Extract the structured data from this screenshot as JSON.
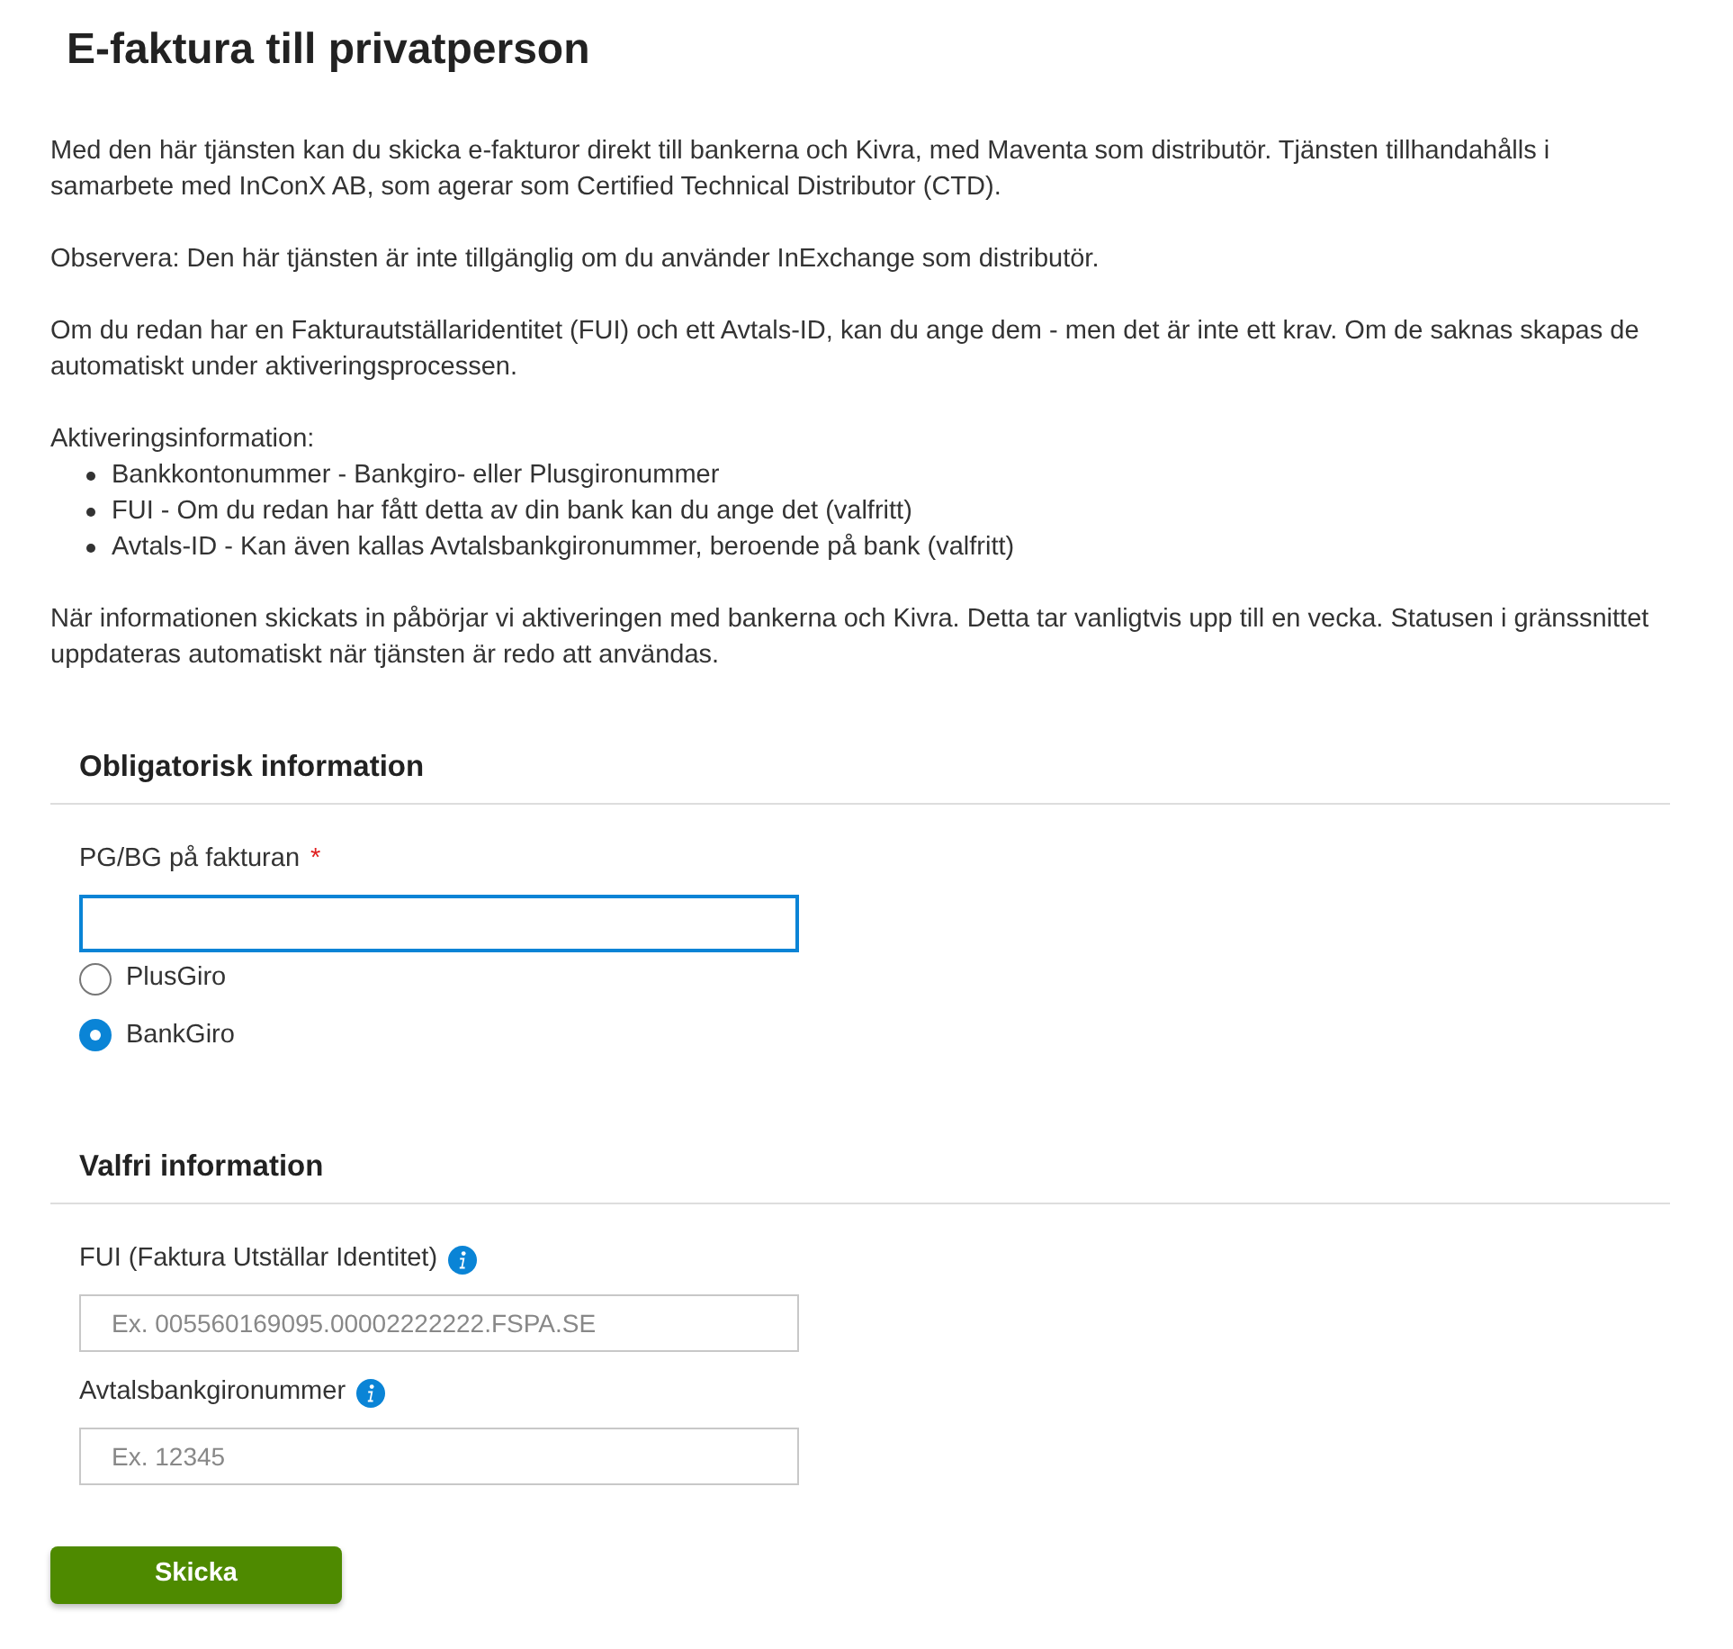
{
  "title": "E-faktura till privatperson",
  "intro": [
    {
      "kind": "paragraph",
      "text": "Med den här tjänsten kan du skicka e-fakturor direkt till bankerna och Kivra, med Maventa som distributör. Tjänsten tillhandahålls i samarbete med InConX AB, som agerar som Certified Technical Distributor (CTD)."
    },
    {
      "kind": "paragraph",
      "text": "Observera: Den här tjänsten är inte tillgänglig om du använder InExchange som distributör."
    },
    {
      "kind": "paragraph",
      "text": "Om du redan har en Fakturautställaridentitet (FUI) och ett Avtals-ID, kan du ange dem - men det är inte ett krav. Om de saknas skapas de automatiskt under aktiveringsprocessen."
    },
    {
      "kind": "list",
      "text": "Aktiveringsinformation:",
      "items": [
        "Bankkontonummer - Bankgiro- eller Plusgironummer",
        "FUI - Om du redan har fått detta av din bank kan du ange det (valfritt)",
        "Avtals-ID - Kan även kallas Avtalsbankgironummer, beroende på bank (valfritt)"
      ]
    },
    {
      "kind": "paragraph",
      "text": "När informationen skickats in påbörjar vi aktiveringen med bankerna och Kivra. Detta tar vanligtvis upp till en vecka. Statusen i gränssnittet uppdateras automatiskt när tjänsten är redo att användas."
    }
  ],
  "sections": [
    {
      "heading": "Obligatorisk information",
      "fields": [
        {
          "kind": "text",
          "label": "PG/BG på fakturan",
          "required_mark": "*",
          "focused": true,
          "info": false
        },
        {
          "kind": "radios",
          "options": [
            {
              "label": "PlusGiro",
              "selected": false
            },
            {
              "label": "BankGiro",
              "selected": true
            }
          ]
        }
      ]
    },
    {
      "heading": "Valfri information",
      "fields": [
        {
          "kind": "text",
          "label": "FUI (Faktura Utställar Identitet)",
          "focused": false,
          "placeholder": "Ex. 005560169095.00002222222.FSPA.SE",
          "info": true
        },
        {
          "kind": "text",
          "label": "Avtalsbankgironummer",
          "focused": false,
          "placeholder": "Ex. 12345",
          "info": true
        }
      ]
    }
  ],
  "submit": "Skicka"
}
